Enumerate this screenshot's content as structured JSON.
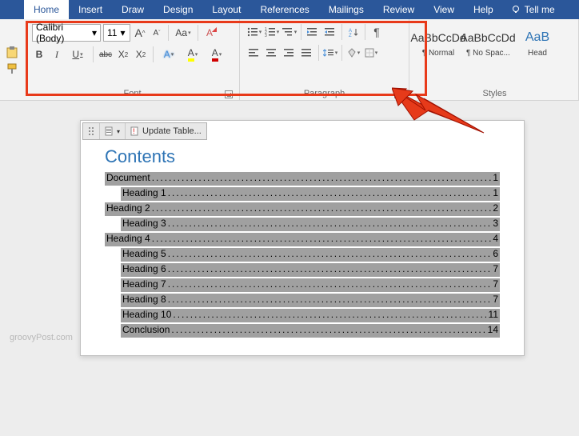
{
  "tabs": [
    "Home",
    "Insert",
    "Draw",
    "Design",
    "Layout",
    "References",
    "Mailings",
    "Review",
    "View",
    "Help"
  ],
  "active_tab": 0,
  "tellme": "Tell me",
  "font": {
    "name": "Calibri (Body)",
    "size": "11",
    "grow": "A",
    "shrink": "A",
    "case": "Aa",
    "clear": "A",
    "bold": "B",
    "italic": "I",
    "underline": "U",
    "strike": "abc",
    "sub": "X",
    "sup": "X",
    "effects": "A",
    "highlight": "A",
    "color": "A",
    "label": "Font"
  },
  "paragraph": {
    "label": "Paragraph"
  },
  "styles": {
    "label": "Styles",
    "items": [
      {
        "sample": "AaBbCcDd",
        "name": "¶ Normal",
        "blue": false
      },
      {
        "sample": "AaBbCcDd",
        "name": "¶ No Spac...",
        "blue": false
      },
      {
        "sample": "AaB",
        "name": "Head",
        "blue": true
      }
    ]
  },
  "toc_toolbar": {
    "update": "Update Table..."
  },
  "toc": {
    "title": "Contents",
    "entries": [
      {
        "text": "Document",
        "page": "1",
        "level": 1
      },
      {
        "text": "Heading 1",
        "page": "1",
        "level": 2
      },
      {
        "text": "Heading 2",
        "page": "2",
        "level": 1
      },
      {
        "text": "Heading 3",
        "page": "3",
        "level": 2
      },
      {
        "text": "Heading 4",
        "page": "4",
        "level": 1
      },
      {
        "text": "Heading 5",
        "page": "6",
        "level": 2
      },
      {
        "text": "Heading 6",
        "page": "7",
        "level": 2
      },
      {
        "text": "Heading 7",
        "page": "7",
        "level": 2
      },
      {
        "text": "Heading 8",
        "page": "7",
        "level": 2
      },
      {
        "text": "Heading 10",
        "page": "11",
        "level": 2
      },
      {
        "text": "Conclusion",
        "page": "14",
        "level": 2
      }
    ]
  },
  "watermark": "groovyPost.com"
}
